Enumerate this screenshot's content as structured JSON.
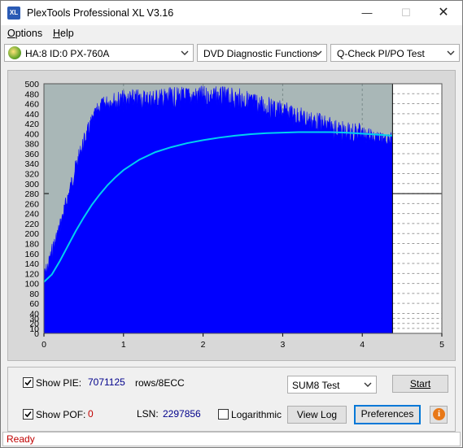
{
  "window": {
    "title": "PlexTools Professional XL V3.16",
    "icon": "XL"
  },
  "menu": [
    {
      "label": "Options",
      "accel": "O",
      "rest": "ptions"
    },
    {
      "label": "Help",
      "accel": "H",
      "rest": "elp"
    }
  ],
  "toolbar": {
    "drive": "HA:8 ID:0  PX-760A",
    "function": "DVD Diagnostic Functions",
    "test": "Q-Check PI/PO Test"
  },
  "controls": {
    "show_pie_label": "Show PIE:",
    "show_pie_checked": true,
    "pie_value": "7071125",
    "pie_unit": "rows/8ECC",
    "show_pof_label": "Show POF:",
    "show_pof_checked": true,
    "pof_value": "0",
    "lsn_label": "LSN:",
    "lsn_value": "2297856",
    "logarithmic_label": "Logarithmic",
    "logarithmic_checked": false,
    "sum_select": "SUM8 Test",
    "start_label": "Start",
    "viewlog_label": "View Log",
    "preferences_label": "Preferences",
    "info_label": "i"
  },
  "status": {
    "text": "Ready"
  },
  "chart_data": {
    "type": "area",
    "xlim": [
      0,
      5
    ],
    "ylim": [
      0,
      500
    ],
    "x_ticks": [
      "0",
      "1",
      "2",
      "3",
      "4",
      "5"
    ],
    "y_ticks": [
      "0",
      "10",
      "20",
      "30",
      "40",
      "60",
      "80",
      "100",
      "120",
      "140",
      "160",
      "180",
      "200",
      "220",
      "240",
      "260",
      "280",
      "300",
      "320",
      "340",
      "360",
      "380",
      "400",
      "420",
      "440",
      "460",
      "480",
      "500"
    ],
    "y_tick_values": [
      0,
      10,
      20,
      30,
      40,
      60,
      80,
      100,
      120,
      140,
      160,
      180,
      200,
      220,
      240,
      260,
      280,
      300,
      320,
      340,
      360,
      380,
      400,
      420,
      440,
      460,
      480,
      500
    ],
    "end_x": 4.38,
    "threshold_y": 280,
    "series": [
      {
        "kind": "PIE",
        "color": "#0000ff",
        "points": [
          [
            0,
            130
          ],
          [
            0.05,
            150
          ],
          [
            0.1,
            180
          ],
          [
            0.2,
            230
          ],
          [
            0.3,
            290
          ],
          [
            0.4,
            350
          ],
          [
            0.5,
            400
          ],
          [
            0.6,
            440
          ],
          [
            0.7,
            470
          ],
          [
            0.8,
            480
          ],
          [
            0.9,
            485
          ],
          [
            1.0,
            488
          ],
          [
            1.2,
            490
          ],
          [
            1.5,
            492
          ],
          [
            1.8,
            495
          ],
          [
            2.0,
            496
          ],
          [
            2.3,
            494
          ],
          [
            2.5,
            490
          ],
          [
            2.7,
            480
          ],
          [
            2.9,
            470
          ],
          [
            3.1,
            460
          ],
          [
            3.3,
            450
          ],
          [
            3.5,
            440
          ],
          [
            3.7,
            428
          ],
          [
            3.9,
            418
          ],
          [
            4.0,
            413
          ],
          [
            4.1,
            405
          ],
          [
            4.2,
            400
          ],
          [
            4.3,
            398
          ],
          [
            4.38,
            397
          ]
        ]
      },
      {
        "kind": "PIF",
        "color": "#00d0f0",
        "points": [
          [
            0,
            103
          ],
          [
            0.1,
            118
          ],
          [
            0.2,
            145
          ],
          [
            0.3,
            175
          ],
          [
            0.4,
            205
          ],
          [
            0.5,
            232
          ],
          [
            0.6,
            257
          ],
          [
            0.7,
            278
          ],
          [
            0.8,
            297
          ],
          [
            0.9,
            313
          ],
          [
            1.0,
            327
          ],
          [
            1.2,
            348
          ],
          [
            1.4,
            363
          ],
          [
            1.6,
            373
          ],
          [
            1.8,
            381
          ],
          [
            2.0,
            387
          ],
          [
            2.2,
            392
          ],
          [
            2.4,
            396
          ],
          [
            2.6,
            399
          ],
          [
            2.8,
            401
          ],
          [
            3.0,
            402
          ],
          [
            3.2,
            403
          ],
          [
            3.4,
            403
          ],
          [
            3.6,
            403
          ],
          [
            3.8,
            402
          ],
          [
            4.0,
            400
          ],
          [
            4.2,
            398
          ],
          [
            4.38,
            396
          ]
        ]
      }
    ]
  }
}
